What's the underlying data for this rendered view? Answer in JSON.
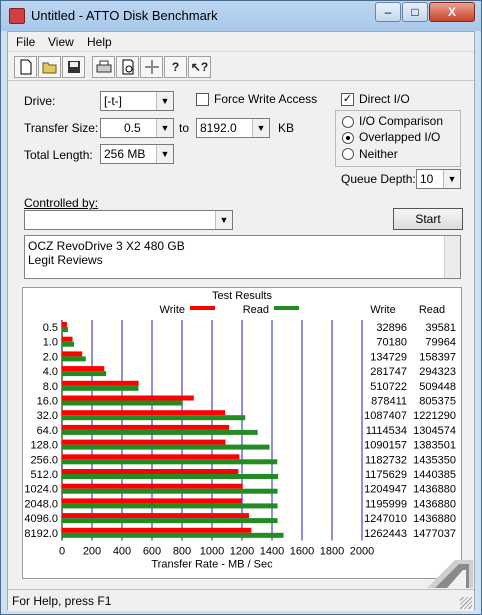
{
  "window": {
    "title": "Untitled - ATTO Disk Benchmark",
    "minimize": "–",
    "maximize": "□",
    "close": "X"
  },
  "menu": [
    "File",
    "View",
    "Help"
  ],
  "toolbar_icons": [
    "new-icon",
    "open-icon",
    "save-icon",
    "print-icon",
    "print-preview-icon",
    "move-icon",
    "help-icon",
    "context-help-icon"
  ],
  "form": {
    "drive_label": "Drive:",
    "drive_value": "[-t-]",
    "force_write_label": "Force Write Access",
    "force_write_checked": false,
    "direct_io_label": "Direct I/O",
    "direct_io_checked": true,
    "transfer_size_label": "Transfer Size:",
    "transfer_from": "0.5",
    "to_label": "to",
    "transfer_to": "8192.0",
    "kb_label": "KB",
    "total_length_label": "Total Length:",
    "total_length_value": "256 MB",
    "io_comparison_label": "I/O Comparison",
    "overlapped_io_label": "Overlapped I/O",
    "neither_label": "Neither",
    "selected_mode": "Overlapped I/O",
    "queue_depth_label": "Queue Depth:",
    "queue_depth_value": "10",
    "controlled_by_label": "Controlled by:",
    "controlled_by_value": "",
    "start_label": "Start",
    "description_lines": [
      "OCZ RevoDrive 3 X2 480 GB",
      "Legit Reviews"
    ]
  },
  "results_title": "Test Results",
  "columns": {
    "write": "Write",
    "read": "Read"
  },
  "colors": {
    "write": "#ff0000",
    "read": "#228b22",
    "grid": "#1f1fbf"
  },
  "chart_data": {
    "type": "bar",
    "orientation": "horizontal",
    "categories": [
      "0.5",
      "1.0",
      "2.0",
      "4.0",
      "8.0",
      "16.0",
      "32.0",
      "64.0",
      "128.0",
      "256.0",
      "512.0",
      "1024.0",
      "2048.0",
      "4096.0",
      "8192.0"
    ],
    "series": [
      {
        "name": "Write",
        "values": [
          32896,
          70180,
          134729,
          281747,
          510722,
          878411,
          1087407,
          1114534,
          1090157,
          1182732,
          1175629,
          1204947,
          1195999,
          1247010,
          1262443
        ]
      },
      {
        "name": "Read",
        "values": [
          39581,
          79964,
          158397,
          294323,
          509448,
          805375,
          1221290,
          1304574,
          1383501,
          1435350,
          1440385,
          1436880,
          1436880,
          1436880,
          1477037
        ]
      }
    ],
    "xlabel": "Transfer Rate - MB / Sec",
    "xticks": [
      "0",
      "200",
      "400",
      "600",
      "800",
      "1000",
      "1200",
      "1400",
      "1600",
      "1800",
      "2000"
    ],
    "xlim": [
      0,
      2000
    ],
    "legend": "top",
    "grid": true
  },
  "status_text": "For Help, press F1"
}
